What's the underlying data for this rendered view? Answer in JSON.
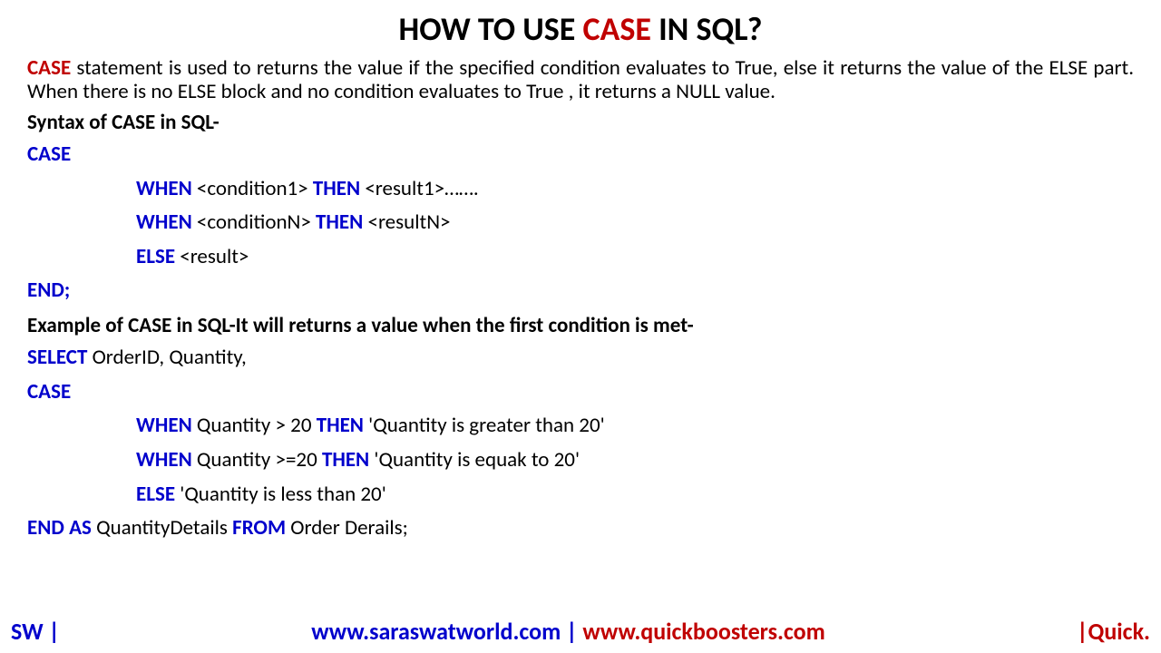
{
  "title": {
    "prefix": "HOW TO USE ",
    "highlight": "CASE",
    "suffix": " IN SQL?"
  },
  "description": {
    "caseword": "CASE",
    "text": " statement is used to returns the value if the specified condition evaluates to True, else it returns the  value of the ELSE part. When there is no ELSE block and no condition evaluates to True , it returns a NULL value."
  },
  "syntax_label": "Syntax of CASE in SQL-",
  "syntax": {
    "case": "CASE",
    "when1_kw": "WHEN",
    "when1_cond": " <condition1> ",
    "then1_kw": "THEN",
    "when1_res": " <result1>…….",
    "whenN_kw": "WHEN",
    "whenN_cond": " <conditionN> ",
    "thenN_kw": "THEN",
    "whenN_res": " <resultN>",
    "else_kw": "ELSE",
    "else_res": " <result>",
    "end": "END;"
  },
  "example_label": "Example of CASE in SQL-It will returns a value when the first condition is met-",
  "example": {
    "select_kw": "SELECT",
    "select_cols": " OrderID, Quantity,",
    "case_kw": "CASE",
    "w1_when": "WHEN",
    "w1_cond": " Quantity > 20 ",
    "w1_then": "THEN",
    "w1_res": "  'Quantity is greater than 20'",
    "w2_when": "WHEN",
    "w2_cond": " Quantity >=20 ",
    "w2_then": "THEN",
    "w2_res": "  'Quantity is equak to 20'",
    "else_kw": "ELSE",
    "else_res": " 'Quantity is less than 20'",
    "end_kw": "END AS",
    "end_col": " QuantityDetails ",
    "from_kw": "FROM",
    "from_tbl": " Order Derails;"
  },
  "footer": {
    "left": "SW |",
    "url1": "www.saraswatworld.com",
    "sep": " | ",
    "url2": "www.quickboosters.com",
    "right": "|Quick."
  }
}
